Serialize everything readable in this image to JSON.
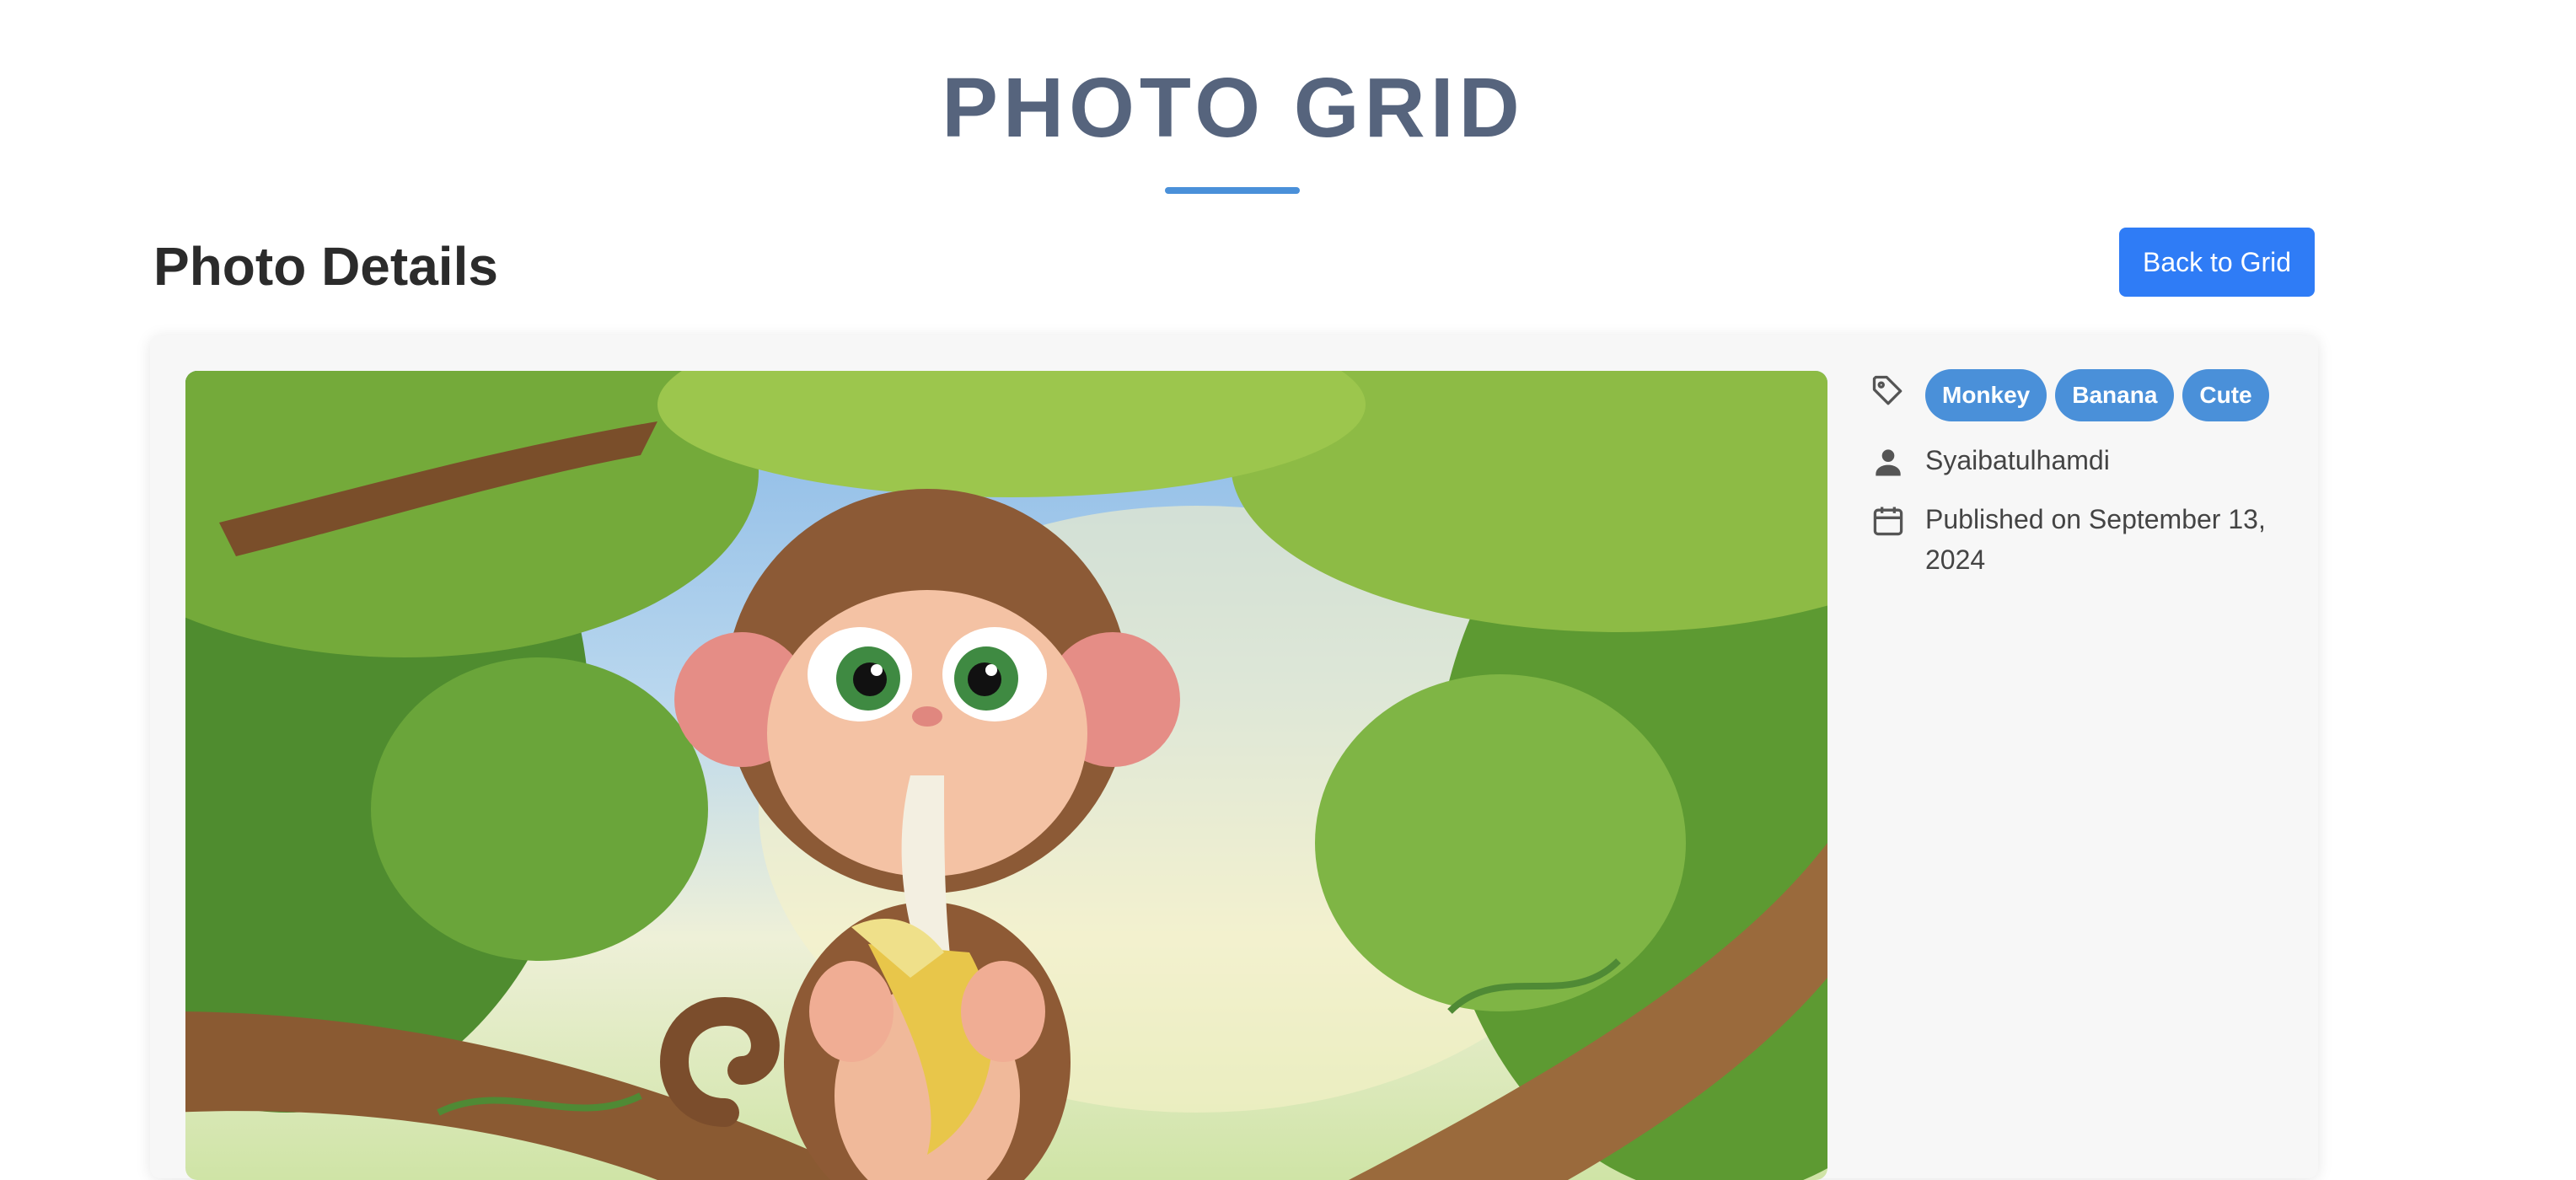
{
  "header": {
    "site_title": "PHOTO GRID"
  },
  "page": {
    "heading": "Photo Details",
    "back_button_label": "Back to Grid"
  },
  "photo": {
    "tags": [
      "Monkey",
      "Banana",
      "Cute"
    ],
    "author": "Syaibatulhamdi",
    "published": "Published on September 13, 2024"
  },
  "colors": {
    "accent": "#4a90d9",
    "button": "#2f7cf6",
    "title": "#56647d"
  },
  "icons": {
    "tags": "tag-icon",
    "author": "user-icon",
    "date": "calendar-icon"
  }
}
